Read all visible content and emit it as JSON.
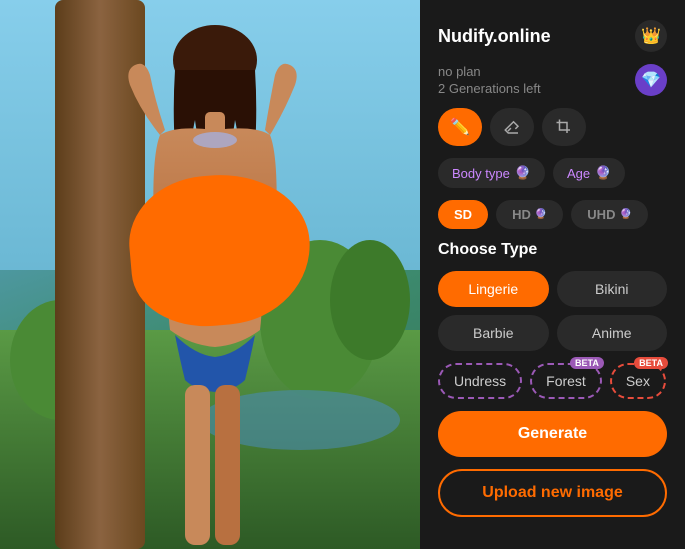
{
  "app": {
    "title": "Nudify.online",
    "crown_icon": "👑",
    "diamond_icon": "💎"
  },
  "plan": {
    "name": "no plan",
    "generations": "2 Generations left"
  },
  "tools": [
    {
      "id": "brush",
      "icon": "✏️",
      "active": true
    },
    {
      "id": "eraser",
      "icon": "⌫",
      "active": false
    },
    {
      "id": "crop",
      "icon": "⊡",
      "active": false
    }
  ],
  "options": {
    "body_type_label": "Body type 🔮",
    "age_label": "Age 🔮"
  },
  "quality": [
    {
      "label": "SD",
      "active": true
    },
    {
      "label": "HD",
      "active": false,
      "locked": true
    },
    {
      "label": "UHD",
      "active": false,
      "locked": true
    }
  ],
  "choose_type": {
    "title": "Choose Type",
    "types": [
      {
        "label": "Lingerie",
        "active": true
      },
      {
        "label": "Bikini",
        "active": false
      },
      {
        "label": "Barbie",
        "active": false
      },
      {
        "label": "Anime",
        "active": false
      }
    ],
    "beta_types": [
      {
        "label": "Undress",
        "beta": false
      },
      {
        "label": "Forest",
        "beta": true,
        "badge_color": "purple"
      },
      {
        "label": "Sex",
        "beta": true,
        "badge_color": "red"
      }
    ]
  },
  "actions": {
    "generate_label": "Generate",
    "upload_label": "Upload new image"
  }
}
